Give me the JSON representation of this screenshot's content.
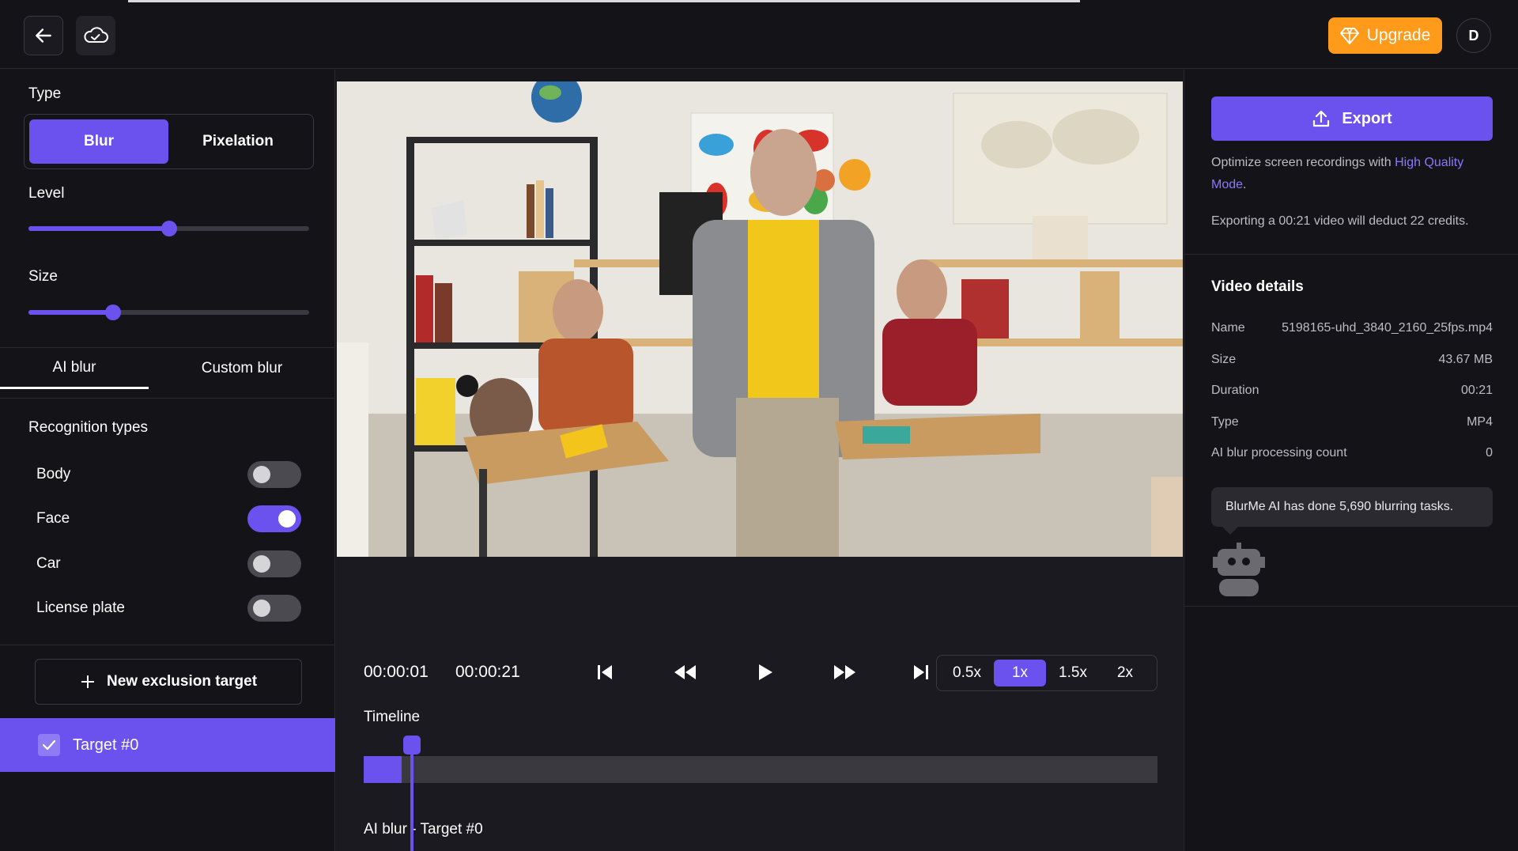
{
  "topbar": {
    "back_icon": "arrow-left-icon",
    "cloud_icon": "cloud-check-icon",
    "upgrade_label": "Upgrade",
    "upgrade_icon": "diamond-icon",
    "avatar_initial": "D",
    "colors": {
      "upgrade": "#ff9a1a",
      "accent": "#6b52ef"
    }
  },
  "left": {
    "type_label": "Type",
    "type_options": [
      "Blur",
      "Pixelation"
    ],
    "type_selected": "Blur",
    "level_label": "Level",
    "level_value": 0.5,
    "size_label": "Size",
    "size_value": 0.3,
    "tabs": [
      "AI blur",
      "Custom blur"
    ],
    "tab_selected": "AI blur",
    "recognition_label": "Recognition types",
    "recognition": [
      {
        "label": "Body",
        "on": false
      },
      {
        "label": "Face",
        "on": true
      },
      {
        "label": "Car",
        "on": false
      },
      {
        "label": "License plate",
        "on": false
      }
    ],
    "new_target_label": "New exclusion target",
    "target_label": "Target #0",
    "target_checked": true
  },
  "player": {
    "current_time": "00:00:01",
    "total_time": "00:00:21",
    "speeds": [
      "0.5x",
      "1x",
      "1.5x",
      "2x"
    ],
    "speed_selected": "1x",
    "timeline_label": "Timeline",
    "track_label": "AI blur - Target #0",
    "progress": 0.048
  },
  "right": {
    "export_label": "Export",
    "optimize_prefix": "Optimize screen recordings with ",
    "optimize_link": "High Quality Mode",
    "optimize_suffix": ".",
    "credits_note": "Exporting a 00:21 video will deduct 22 credits.",
    "details_title": "Video details",
    "details": [
      {
        "key": "Name",
        "value": "5198165-uhd_3840_2160_25fps.mp4"
      },
      {
        "key": "Size",
        "value": "43.67 MB"
      },
      {
        "key": "Duration",
        "value": "00:21"
      },
      {
        "key": "Type",
        "value": "MP4"
      },
      {
        "key": "AI blur processing count",
        "value": "0"
      }
    ],
    "tooltip": "BlurMe AI has done 5,690 blurring tasks.",
    "robot_icon": "robot-icon"
  }
}
